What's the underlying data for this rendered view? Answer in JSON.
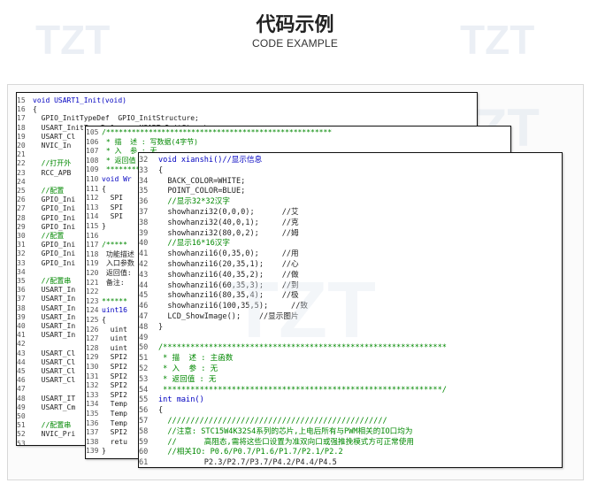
{
  "header": {
    "title": "代码示例",
    "subtitle": "CODE EXAMPLE"
  },
  "watermark": {
    "logo_text": "TZT"
  },
  "panels": {
    "back": {
      "lines": [
        {
          "n": "15",
          "t": "void USART1_Init(void)"
        },
        {
          "n": "16",
          "t": "{"
        },
        {
          "n": "17",
          "t": "  GPIO_InitTypeDef  GPIO_InitStructure;"
        },
        {
          "n": "18",
          "t": "  USART_InitTypeDef      USART_InitStructure;"
        },
        {
          "n": "19",
          "t": "  USART_Cl"
        },
        {
          "n": "20",
          "t": "  NVIC_In"
        },
        {
          "n": "21",
          "t": ""
        },
        {
          "n": "22",
          "t": "  //打开外"
        },
        {
          "n": "23",
          "t": "  RCC_APB"
        },
        {
          "n": "24",
          "t": ""
        },
        {
          "n": "25",
          "t": "  //配置"
        },
        {
          "n": "26",
          "t": "  GPIO_Ini"
        },
        {
          "n": "27",
          "t": "  GPIO_Ini"
        },
        {
          "n": "28",
          "t": "  GPIO_Ini"
        },
        {
          "n": "29",
          "t": "  GPIO_Ini"
        },
        {
          "n": "30",
          "t": "  //配置"
        },
        {
          "n": "31",
          "t": "  GPIO_Ini"
        },
        {
          "n": "32",
          "t": "  GPIO_Ini"
        },
        {
          "n": "33",
          "t": "  GPIO_Ini"
        },
        {
          "n": "34",
          "t": ""
        },
        {
          "n": "35",
          "t": "  //配置串"
        },
        {
          "n": "36",
          "t": "  USART_In"
        },
        {
          "n": "37",
          "t": "  USART_In"
        },
        {
          "n": "38",
          "t": "  USART_In"
        },
        {
          "n": "39",
          "t": "  USART_In"
        },
        {
          "n": "40",
          "t": "  USART_In"
        },
        {
          "n": "41",
          "t": "  USART_In"
        },
        {
          "n": "42",
          "t": ""
        },
        {
          "n": "43",
          "t": "  USART_Cl"
        },
        {
          "n": "44",
          "t": "  USART_Cl"
        },
        {
          "n": "45",
          "t": "  USART_Cl"
        },
        {
          "n": "46",
          "t": "  USART_Cl"
        },
        {
          "n": "47",
          "t": ""
        },
        {
          "n": "48",
          "t": "  USART_IT"
        },
        {
          "n": "49",
          "t": "  USART_Cm"
        },
        {
          "n": "50",
          "t": ""
        },
        {
          "n": "51",
          "t": "  //配置串"
        },
        {
          "n": "52",
          "t": "  NVIC_Pri"
        },
        {
          "n": "53",
          "t": ""
        }
      ]
    },
    "middle": {
      "lines": [
        {
          "n": "105",
          "t": "/*****************************************************"
        },
        {
          "n": "106",
          "t": " * 描  述 : 写数据(4字节)"
        },
        {
          "n": "107",
          "t": " * 入  参 : 无"
        },
        {
          "n": "108",
          "t": " * 返回值 :"
        },
        {
          "n": "109",
          "t": " ***********"
        },
        {
          "n": "110",
          "t": "void Wr"
        },
        {
          "n": "111",
          "t": "{"
        },
        {
          "n": "112",
          "t": "  SPI"
        },
        {
          "n": "113",
          "t": "  SPI"
        },
        {
          "n": "114",
          "t": "  SPI"
        },
        {
          "n": "115",
          "t": "}"
        },
        {
          "n": "116",
          "t": ""
        },
        {
          "n": "117",
          "t": "/*****"
        },
        {
          "n": "118",
          "t": " 功能描述"
        },
        {
          "n": "119",
          "t": " 入口参数"
        },
        {
          "n": "120",
          "t": " 返回值:"
        },
        {
          "n": "121",
          "t": " 备注:"
        },
        {
          "n": "122",
          "t": ""
        },
        {
          "n": "123",
          "t": "******"
        },
        {
          "n": "124",
          "t": "uint16"
        },
        {
          "n": "125",
          "t": "{"
        },
        {
          "n": "126",
          "t": "  uint"
        },
        {
          "n": "127",
          "t": "  uint"
        },
        {
          "n": "128",
          "t": "  uint"
        },
        {
          "n": "129",
          "t": "  SPI2"
        },
        {
          "n": "130",
          "t": "  SPI2"
        },
        {
          "n": "131",
          "t": "  SPI2"
        },
        {
          "n": "132",
          "t": "  SPI2"
        },
        {
          "n": "133",
          "t": "  SPI2"
        },
        {
          "n": "134",
          "t": "  Temp"
        },
        {
          "n": "135",
          "t": "  Temp"
        },
        {
          "n": "136",
          "t": "  Temp"
        },
        {
          "n": "137",
          "t": "  SPI2"
        },
        {
          "n": "138",
          "t": "  retu"
        },
        {
          "n": "139",
          "t": "}"
        }
      ]
    },
    "front": {
      "lines": [
        {
          "n": "32",
          "t": "void xianshi()//显示信息"
        },
        {
          "n": "33",
          "t": "{"
        },
        {
          "n": "34",
          "t": "  BACK_COLOR=WHITE;"
        },
        {
          "n": "35",
          "t": "  POINT_COLOR=BLUE;"
        },
        {
          "n": "36",
          "t": "  //显示32*32汉字"
        },
        {
          "n": "37",
          "t": "  showhanzi32(0,0,0);      //艾"
        },
        {
          "n": "38",
          "t": "  showhanzi32(40,0,1);     //克"
        },
        {
          "n": "39",
          "t": "  showhanzi32(80,0,2);     //姆"
        },
        {
          "n": "40",
          "t": "  //显示16*16汉字"
        },
        {
          "n": "41",
          "t": "  showhanzi16(0,35,0);     //用"
        },
        {
          "n": "42",
          "t": "  showhanzi16(20,35,1);    //心"
        },
        {
          "n": "43",
          "t": "  showhanzi16(40,35,2);    //做"
        },
        {
          "n": "44",
          "t": "  showhanzi16(60,35,3);    //到"
        },
        {
          "n": "45",
          "t": "  showhanzi16(80,35,4);    //极"
        },
        {
          "n": "46",
          "t": "  showhanzi16(100,35,5);     //致"
        },
        {
          "n": "47",
          "t": "  LCD_ShowImage();    //显示图片"
        },
        {
          "n": "48",
          "t": "}"
        },
        {
          "n": "49",
          "t": ""
        },
        {
          "n": "50",
          "t": "/**************************************************************"
        },
        {
          "n": "51",
          "t": " * 描  述 : 主函数"
        },
        {
          "n": "52",
          "t": " * 入  参 : 无"
        },
        {
          "n": "53",
          "t": " * 返回值 : 无"
        },
        {
          "n": "54",
          "t": " *************************************************************/"
        },
        {
          "n": "55",
          "t": "int main()"
        },
        {
          "n": "56",
          "t": "{"
        },
        {
          "n": "57",
          "t": "  ////////////////////////////////////////////////"
        },
        {
          "n": "58",
          "t": "  //注意: STC15W4K32S4系列的芯片,上电后所有与PWM相关的IO口均为"
        },
        {
          "n": "59",
          "t": "  //      高阻态,需将这些口设置为准双向口或强推挽模式方可正常使用"
        },
        {
          "n": "60",
          "t": "  //相关IO: P0.6/P0.7/P1.6/P1.7/P2.1/P2.2"
        },
        {
          "n": "61",
          "t": "          P2.3/P2.7/P3.7/P4.2/P4.4/P4.5"
        }
      ]
    }
  }
}
